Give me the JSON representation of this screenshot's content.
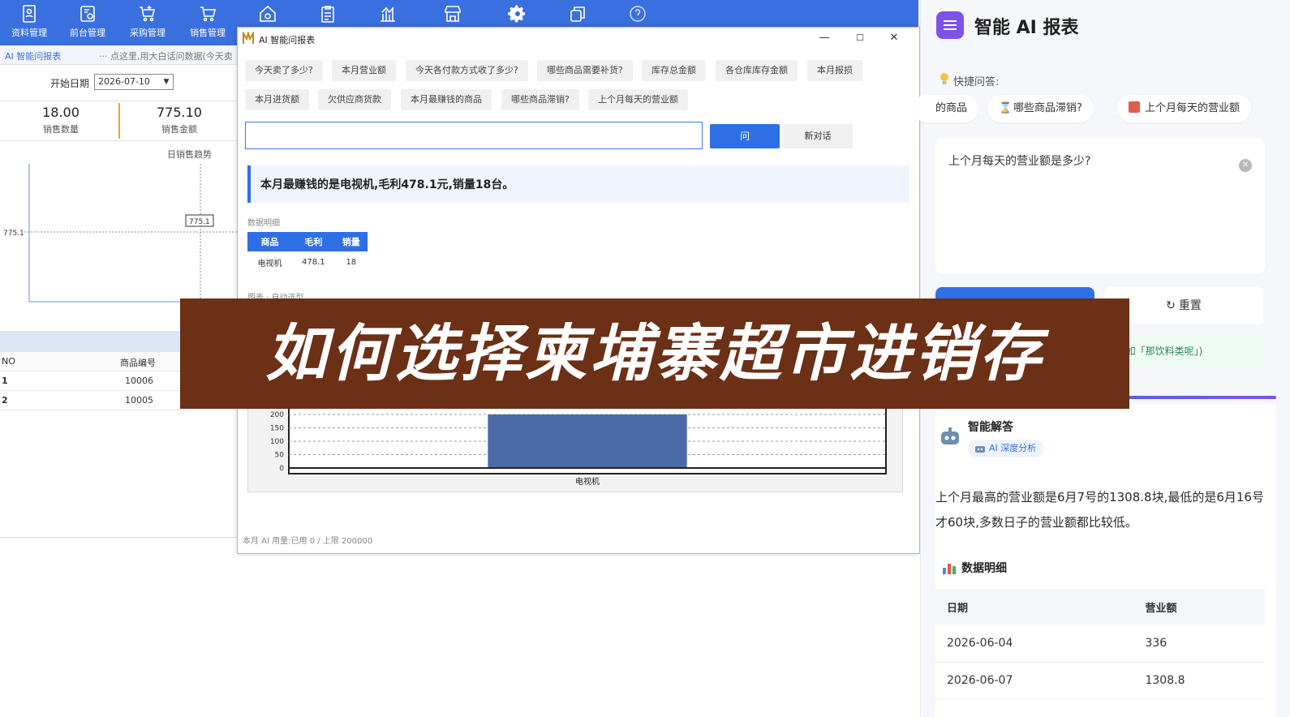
{
  "toolbar": {
    "items": [
      {
        "label": "资料管理",
        "icon": "document-person-icon"
      },
      {
        "label": "前台管理",
        "icon": "register-icon"
      },
      {
        "label": "采购管理",
        "icon": "cart-plus-icon"
      },
      {
        "label": "销售管理",
        "icon": "cart-icon"
      },
      {
        "label": "",
        "icon": "house-gear-icon"
      },
      {
        "label": "",
        "icon": "clipboard-icon"
      },
      {
        "label": "",
        "icon": "bar-chart-icon"
      },
      {
        "label": "",
        "icon": "store-icon"
      },
      {
        "label": "",
        "icon": "gear-icon"
      },
      {
        "label": "",
        "icon": "copy-windows-icon"
      },
      {
        "label": "",
        "icon": "help-icon"
      }
    ]
  },
  "background": {
    "active_tab": "AI 智能问报表",
    "hint": "··· 点这里,用大白话问数据(今天卖",
    "date_label": "开始日期",
    "date_value": "2026-07-10",
    "stats": [
      {
        "value": "18.00",
        "label": "销售数量"
      },
      {
        "value": "775.10",
        "label": "销售金额"
      }
    ],
    "trend": {
      "title": "日销售趋势",
      "y_label": "775.1",
      "point_label": "775.1"
    },
    "table": {
      "headers": [
        "NO",
        "商品编号"
      ],
      "rows": [
        [
          "1",
          "10006"
        ],
        [
          "2",
          "10005"
        ]
      ]
    }
  },
  "dialog": {
    "title": "AI 智能问报表",
    "controls": {
      "minimize": "—",
      "maximize": "☐",
      "close": "✕"
    },
    "quick_row1": [
      "今天卖了多少?",
      "本月营业额",
      "今天各付款方式收了多少?",
      "哪些商品需要补货?",
      "库存总金额",
      "各仓库库存金额",
      "本月报损"
    ],
    "quick_row2": [
      "本月进货额",
      "欠供应商货款",
      "本月最赚钱的商品",
      "哪些商品滞销?",
      "上个月每天的营业额"
    ],
    "input_value": "",
    "ask_label": "问",
    "new_chat_label": "新对话",
    "answer": "本月最赚钱的是电视机,毛利478.1元,销量18台。",
    "detail_label": "数据明细",
    "detail_table": {
      "headers": [
        "商品",
        "毛利",
        "销量"
      ],
      "rows": [
        [
          "电视机",
          "478.1",
          "18"
        ]
      ]
    },
    "chart_label": "图表 · 自动选型",
    "usage": "本月 AI 用量:已用 0 / 上限 200000"
  },
  "chart_data": {
    "type": "bar",
    "title": "",
    "categories": [
      "电视机"
    ],
    "values": [
      478.1
    ],
    "xlabel": "",
    "ylabel": "",
    "yticks": [
      0,
      50,
      100,
      150,
      200
    ],
    "color": "#4a6aa8",
    "grid": true
  },
  "right_panel": {
    "title": "智能 AI 报表",
    "quick_label": "快捷问答:",
    "chips": [
      {
        "icon": "",
        "label": "的商品"
      },
      {
        "icon": "hourglass-icon",
        "label": "哪些商品滞销?"
      },
      {
        "icon": "calendar-icon",
        "label": "上个月每天的营业额"
      }
    ],
    "question": "上个月每天的营业额是多少?",
    "reset_label": "重置",
    "hint": "(如「那饮料类呢」)",
    "answer_title": "智能解答",
    "answer_badge": "AI 深度分析",
    "answer_text": "上个月最高的营业额是6月7号的1308.8块,最低的是6月16号才60块,多数日子的营业额都比较低。",
    "detail_title": "数据明细",
    "table": {
      "headers": [
        "日期",
        "营业额"
      ],
      "rows": [
        [
          "2026-06-04",
          "336"
        ],
        [
          "2026-06-07",
          "1308.8"
        ]
      ]
    }
  },
  "banner": {
    "text": "如何选择柬埔寨超市进销存",
    "color": "#6b3016"
  }
}
